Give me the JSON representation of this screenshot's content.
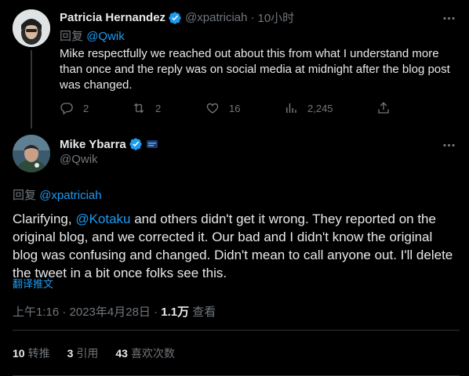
{
  "reply_tweet": {
    "author_name": "Patricia Hernandez",
    "handle": "@xpatriciah",
    "separator": "·",
    "time": "10小时",
    "reply_prefix": "回复",
    "reply_to": "@Qwik",
    "text": "Mike respectfully we reached out about this from what I understand more than once and the reply was on social media at midnight after the blog post was changed.",
    "actions": {
      "replies": "2",
      "retweets": "2",
      "likes": "16",
      "views": "2,245"
    }
  },
  "main_tweet": {
    "author_name": "Mike Ybarra",
    "handle": "@Qwik",
    "reply_prefix": "回复",
    "reply_to": "@xpatriciah",
    "text_before": "Clarifying, ",
    "mention": "@Kotaku",
    "text_after": "  and others didn't get it wrong. They reported on the original blog, and we corrected it. Our bad and I didn't know the original blog was confusing and changed. Didn't mean to call anyone out. I'll delete the tweet in a bit once folks see this.",
    "translate": "翻译推文",
    "timestamp": "上午1:16 · 2023年4月28日 · ",
    "views_count": "1.1万",
    "views_label": " 查看",
    "stats": {
      "retweets_count": "10",
      "retweets_label": "转推",
      "quotes_count": "3",
      "quotes_label": "引用",
      "likes_count": "43",
      "likes_label": "喜欢次数"
    }
  },
  "colors": {
    "background": "#000000",
    "text": "#e7e9ea",
    "muted": "#71767b",
    "accent": "#1d9bf0",
    "divider": "#2f3336"
  }
}
